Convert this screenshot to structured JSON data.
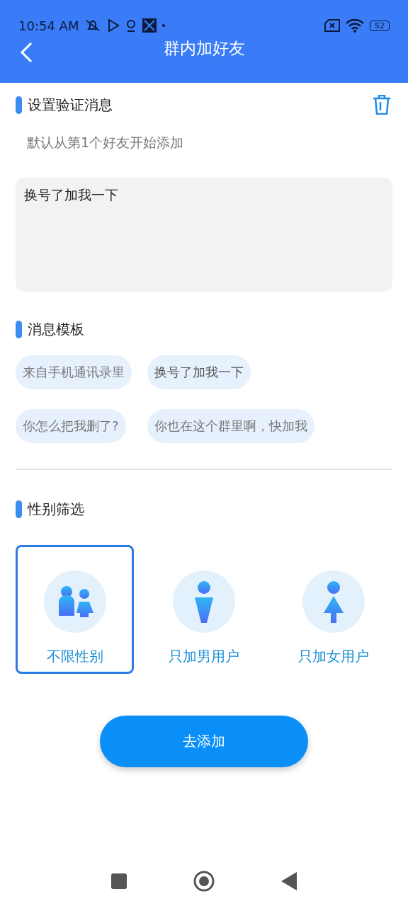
{
  "status_bar": {
    "time": "10:54 AM",
    "battery": "52"
  },
  "header": {
    "title": "群内加好友"
  },
  "verify": {
    "heading": "设置验证消息",
    "hint": "默认从第1个好友开始添加",
    "message": "换号了加我一下"
  },
  "templates": {
    "heading": "消息模板",
    "items": [
      {
        "label": "来自手机通讯录里"
      },
      {
        "label": "换号了加我一下"
      },
      {
        "label": "你怎么把我删了?"
      },
      {
        "label": "你也在这个群里啊，快加我"
      }
    ]
  },
  "gender": {
    "heading": "性别筛选",
    "options": [
      {
        "label": "不限性别",
        "kind": "any",
        "selected": true
      },
      {
        "label": "只加男用户",
        "kind": "male",
        "selected": false
      },
      {
        "label": "只加女用户",
        "kind": "female",
        "selected": false
      }
    ]
  },
  "submit": {
    "label": "去添加"
  }
}
